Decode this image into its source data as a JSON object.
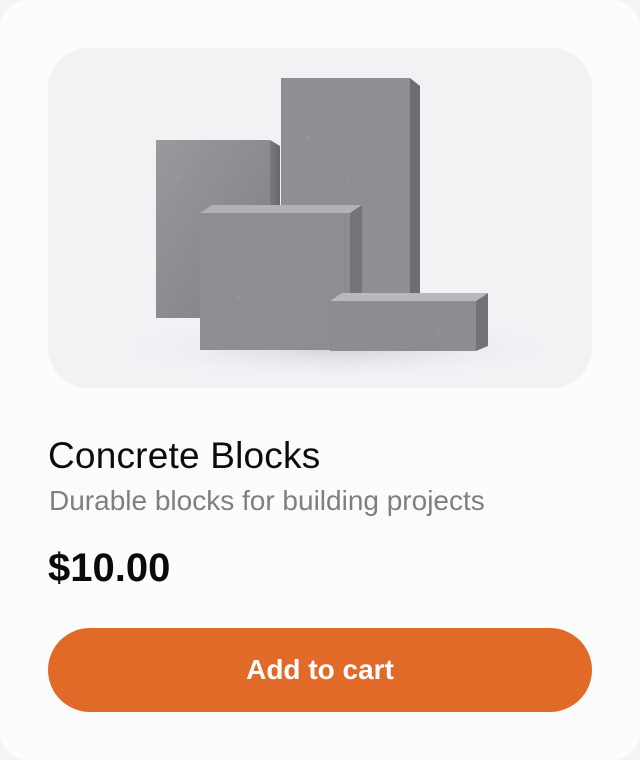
{
  "product": {
    "image_icon": "concrete-blocks-image",
    "title": "Concrete Blocks",
    "description": "Durable blocks for building projects",
    "price": "$10.00",
    "add_to_cart_label": "Add to cart"
  },
  "colors": {
    "button": "#e26a28",
    "title": "#0c0c0c",
    "description": "#7f7f82",
    "image_background": "#f3f1f4"
  }
}
